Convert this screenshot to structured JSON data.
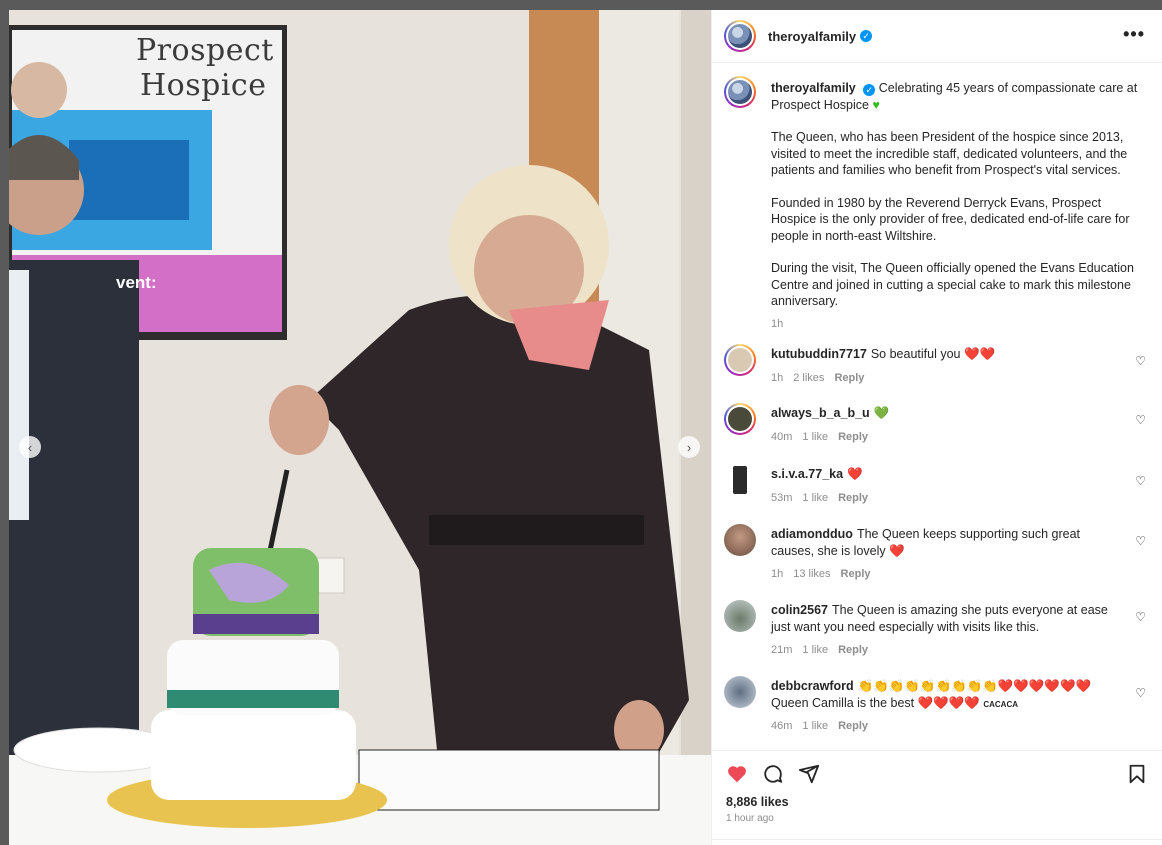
{
  "post": {
    "username": "theroyalfamily",
    "more_label": "•••",
    "caption": {
      "username": "theroyalfamily",
      "line1": "Celebrating 45 years of compassionate care at Prospect Hospice",
      "para1": "The Queen, who has been President of the hospice since 2013, visited to meet the incredible staff, dedicated volunteers, and the patients and families who benefit from Prospect's vital services.",
      "para2": "Founded in 1980 by the Reverend Derryck Evans, Prospect Hospice is the only provider of free, dedicated end-of-life care for people in north-east Wiltshire.",
      "para3": "During the visit, The Queen officially opened the Evans Education Centre and joined in cutting a special cake to mark this milestone anniversary.",
      "time": "1h"
    },
    "comments": [
      {
        "user": "kutubuddin7717",
        "text": "So beautiful you",
        "hearts": "❤️❤️",
        "time": "1h",
        "likes": "2 likes",
        "reply": "Reply"
      },
      {
        "user": "always_b_a_b_u",
        "text": "",
        "hearts": "💚",
        "time": "40m",
        "likes": "1 like",
        "reply": "Reply"
      },
      {
        "user": "s.i.v.a.77_ka",
        "text": "",
        "hearts": "❤️",
        "time": "53m",
        "likes": "1 like",
        "reply": "Reply"
      },
      {
        "user": "adiamondduo",
        "text": "The Queen keeps supporting such great causes, she is lovely",
        "hearts": "❤️",
        "time": "1h",
        "likes": "13 likes",
        "reply": "Reply"
      },
      {
        "user": "colin2567",
        "text": "The Queen is amazing she puts everyone at ease just want you need especially with visits like this.",
        "hearts": "",
        "time": "21m",
        "likes": "1 like",
        "reply": "Reply"
      },
      {
        "user": "debbcrawford",
        "text": "👏👏👏👏👏👏👏👏👏❤️❤️❤️❤️❤️❤️ Queen Camilla is the best ❤️❤️❤️❤️",
        "hearts": "CACACA",
        "time": "46m",
        "likes": "1 like",
        "reply": "Reply"
      }
    ],
    "likes": "8,886 likes",
    "posted": "1 hour ago"
  },
  "photo": {
    "tv_line1": "Prospect",
    "tv_line2": "Hospice",
    "tv_event": "vent:",
    "prev": "‹",
    "next": "›"
  },
  "icons": [
    "verified-badge",
    "heart-icon",
    "comment-icon",
    "share-icon",
    "bookmark-icon",
    "more-icon"
  ],
  "colors": {
    "like_red": "#ed4956",
    "verified": "#0095f6",
    "meta_gray": "#8e8e8e"
  }
}
